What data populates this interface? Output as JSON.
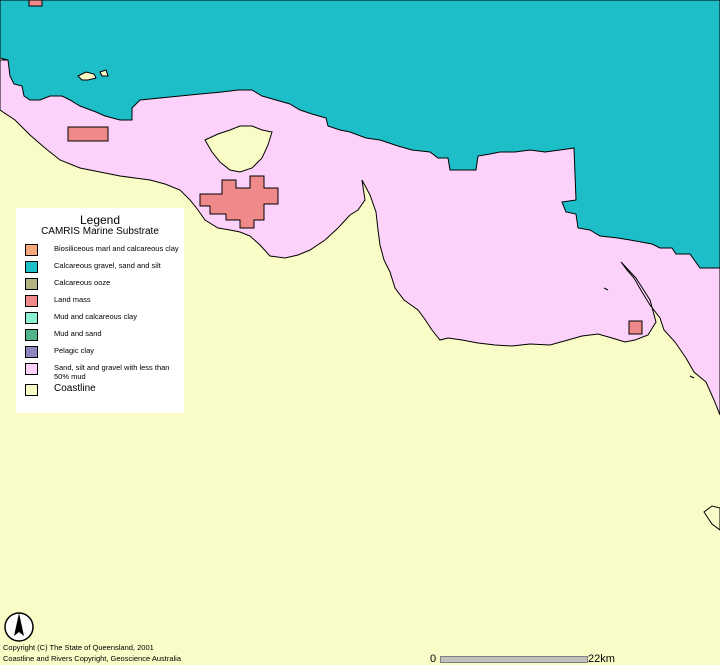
{
  "legend": {
    "title": "Legend",
    "subtitle": "CAMRIS Marine Substrate",
    "items": [
      {
        "label": "Biosiliceous marl and calcareous clay",
        "color": "#f5a87a"
      },
      {
        "label": "Calcareous gravel, sand and silt",
        "color": "#1ebec8"
      },
      {
        "label": "Calcareous ooze",
        "color": "#b4b482"
      },
      {
        "label": "Land mass",
        "color": "#f08a8a"
      },
      {
        "label": "Mud and calcareous clay",
        "color": "#8af0d2"
      },
      {
        "label": "Mud and sand",
        "color": "#50b48a"
      },
      {
        "label": "Pelagic clay",
        "color": "#8c87c3"
      },
      {
        "label": "Sand, silt and gravel with less than 50% mud",
        "color": "#fcd2fa"
      },
      {
        "label": "Coastline",
        "color": "#fafcc8"
      }
    ]
  },
  "copyright": {
    "line1": "Copyright (C) The State of Queensland, 2001",
    "line2": "Coastline and Rivers Copyright, Geoscience Australia"
  },
  "scale": {
    "start_label": "0",
    "end_label": "22km"
  },
  "map_layers": {
    "calcareous_color": "#1ebec8",
    "sand_color": "#fcd2fa",
    "land_mass_color": "#f08a8a",
    "coast_color": "#fafcc8"
  }
}
